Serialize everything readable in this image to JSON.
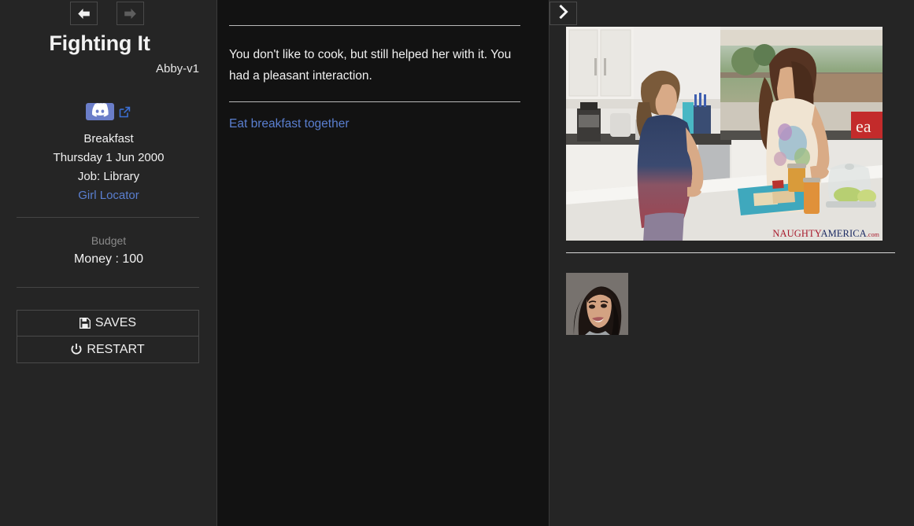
{
  "sidebar": {
    "nav": {
      "back_icon": "arrow-left-icon",
      "forward_icon": "arrow-right-icon"
    },
    "title": "Fighting It",
    "subtitle": "Abby-v1",
    "discord": {
      "icon": "discord-icon",
      "external_link_icon": "external-link-icon"
    },
    "status": {
      "meal": "Breakfast",
      "date": "Thursday 1 Jun 2000",
      "job": "Job: Library",
      "locator_link": "Girl Locator"
    },
    "budget": {
      "label": "Budget",
      "money": "Money : 100"
    },
    "buttons": [
      {
        "label": "SAVES",
        "icon": "floppy-disk-icon"
      },
      {
        "label": "RESTART",
        "icon": "power-icon"
      }
    ]
  },
  "center": {
    "story": "You don't like to cook, but still helped her with it. You had a pleasant interaction.",
    "choice": "Eat breakfast together"
  },
  "right": {
    "toggle_icon": "chevron-right-icon",
    "scene_image": "kitchen-scene-photo",
    "watermark": {
      "part1": "NAUGHTY",
      "part2": "AMERICA",
      "part3": ".com"
    },
    "thumbnail": "character-portrait-thumbnail"
  },
  "colors": {
    "sidebar_bg": "#252525",
    "center_bg": "#121212",
    "link": "#5a7fd0",
    "discord_blurple": "#6b7ec9",
    "text": "#f0f0f0",
    "muted": "#8a8a8a"
  }
}
